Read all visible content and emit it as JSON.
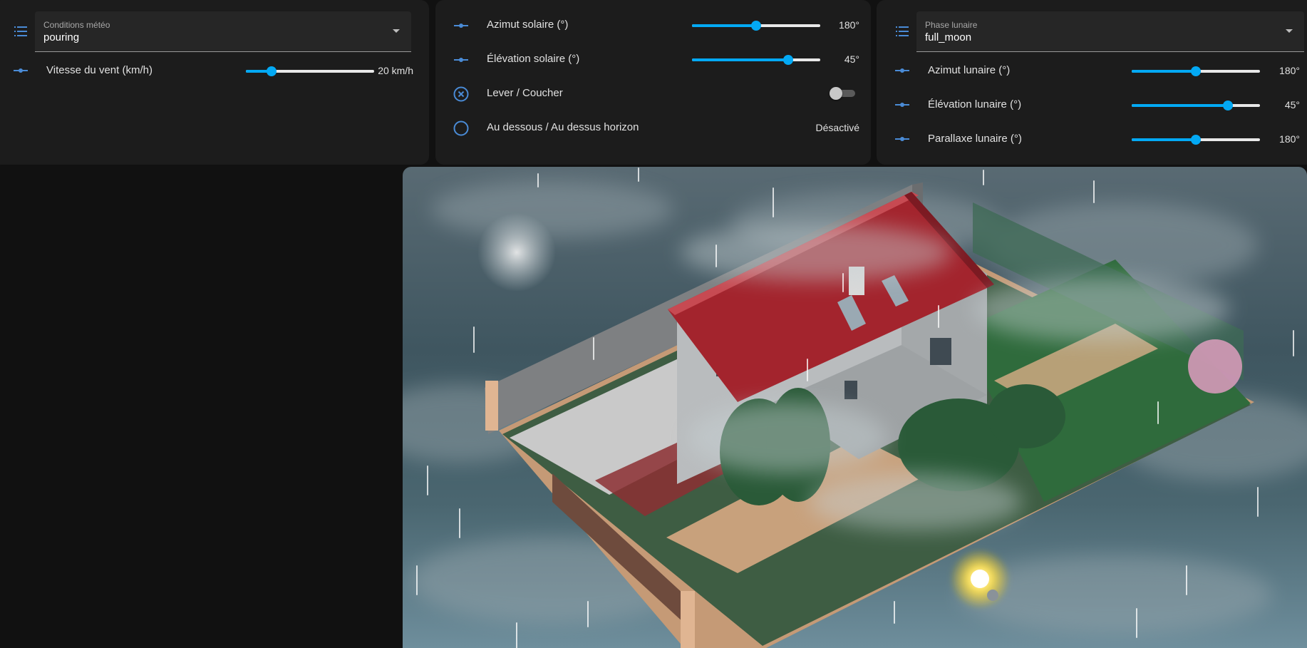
{
  "weather": {
    "conditions_label": "Conditions météo",
    "conditions_value": "pouring",
    "wind_label": "Vitesse du vent (km/h)",
    "wind_value": 20,
    "wind_display": "20 km/h",
    "wind_level": 0.2
  },
  "sun": {
    "azimuth_label": "Azimut solaire (°)",
    "azimuth_display": "180°",
    "azimuth_level": 0.5,
    "elevation_label": "Élévation solaire (°)",
    "elevation_display": "45°",
    "elevation_level": 0.75,
    "rise_set_label": "Lever / Coucher",
    "rise_set_on": false,
    "horizon_label": "Au dessous / Au dessus horizon",
    "horizon_value": "Désactivé"
  },
  "moon": {
    "phase_label": "Phase lunaire",
    "phase_value": "full_moon",
    "azimuth_label": "Azimut lunaire (°)",
    "azimuth_display": "180°",
    "azimuth_level": 0.5,
    "elevation_label": "Élévation lunaire (°)",
    "elevation_display": "45°",
    "elevation_level": 0.75,
    "parallax_label": "Parallaxe lunaire (°)",
    "parallax_display": "180°",
    "parallax_level": 0.5
  },
  "colors": {
    "accent": "#03a9f4",
    "icon": "#4a8bd6",
    "card": "#1c1c1c",
    "background": "#111111",
    "sun": "#ffe45c",
    "roof": "#a3242d",
    "lawn": "#2f6b3c"
  },
  "icons": {
    "select": "list-icon",
    "slider": "slider-icon",
    "rise_set": "close-circle-icon",
    "horizon": "circle-outline-icon"
  }
}
